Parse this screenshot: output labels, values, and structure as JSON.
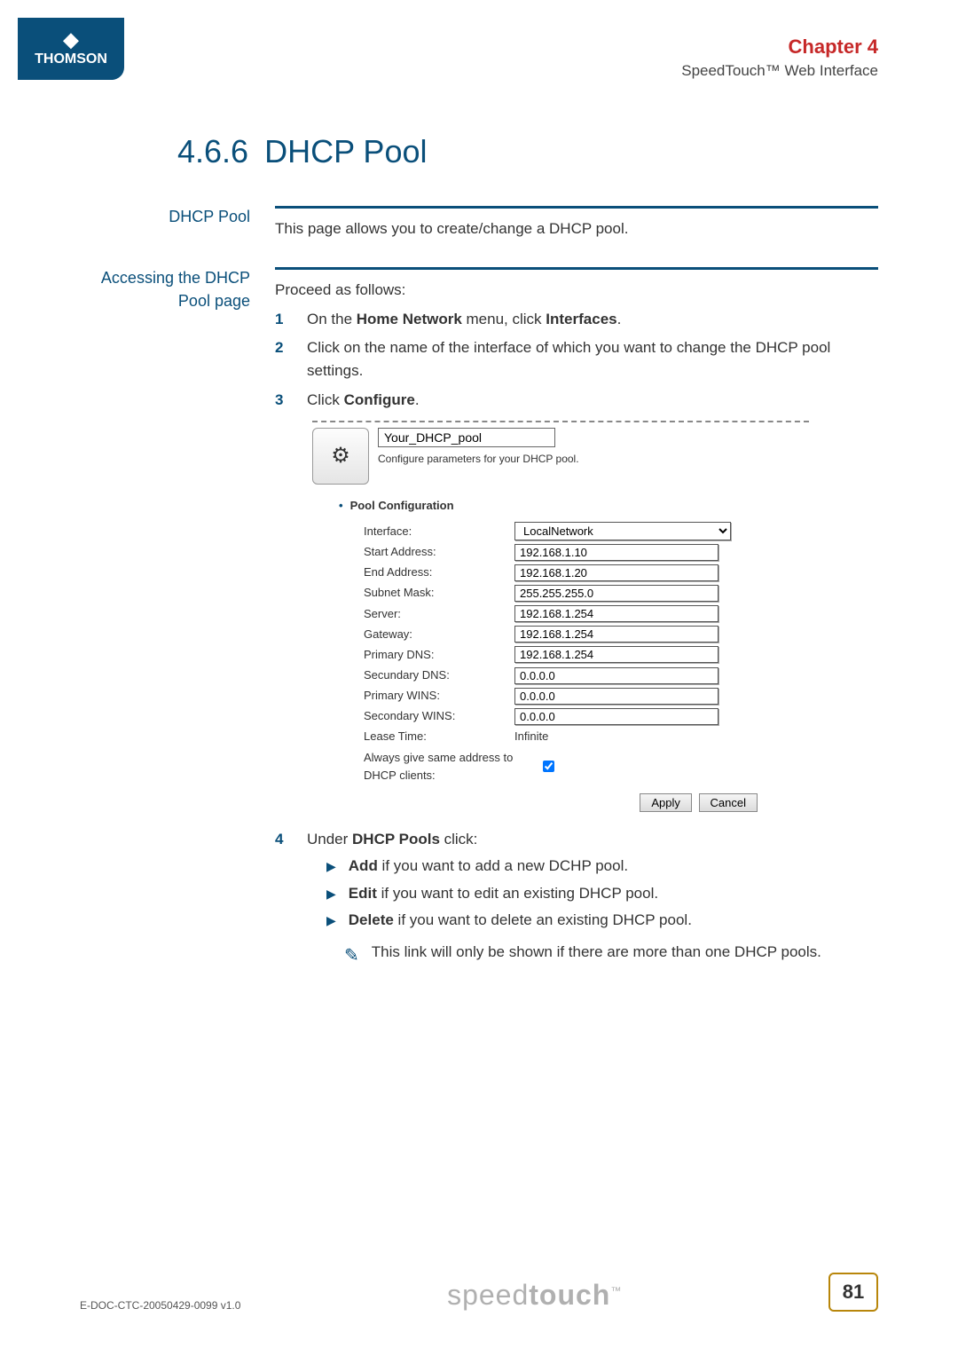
{
  "header": {
    "brand": "THOMSON",
    "chapter": "Chapter 4",
    "subtitle": "SpeedTouch™ Web Interface"
  },
  "section": {
    "num": "4.6.6",
    "title": "DHCP Pool"
  },
  "block1": {
    "margin": "DHCP Pool",
    "text": "This page allows you to create/change a DHCP pool."
  },
  "block2": {
    "margin_l1": "Accessing the DHCP",
    "margin_l2": "Pool page",
    "intro": "Proceed as follows:",
    "steps": [
      {
        "n": "1",
        "pre": "On the ",
        "b": "Home Network",
        "mid": " menu, click ",
        "b2": "Interfaces",
        "post": "."
      },
      {
        "n": "2",
        "text": "Click on the name of the interface of which you want to change the DHCP pool settings."
      },
      {
        "n": "3",
        "pre": "Click ",
        "b": "Configure",
        "post": "."
      }
    ]
  },
  "pool": {
    "name_value": "Your_DHCP_pool",
    "desc": "Configure parameters for your DHCP pool.",
    "section_title": "Pool Configuration",
    "fields": {
      "interface_label": "Interface:",
      "interface_value": "LocalNetwork",
      "start_label": "Start Address:",
      "start_value": "192.168.1.10",
      "end_label": "End Address:",
      "end_value": "192.168.1.20",
      "mask_label": "Subnet Mask:",
      "mask_value": "255.255.255.0",
      "server_label": "Server:",
      "server_value": "192.168.1.254",
      "gateway_label": "Gateway:",
      "gateway_value": "192.168.1.254",
      "pdns_label": "Primary DNS:",
      "pdns_value": "192.168.1.254",
      "sdns_label": "Secundary DNS:",
      "sdns_value": "0.0.0.0",
      "pwins_label": "Primary WINS:",
      "pwins_value": "0.0.0.0",
      "swins_label": "Secondary WINS:",
      "swins_value": "0.0.0.0",
      "lease_label": "Lease Time:",
      "lease_value": "Infinite",
      "same_addr_label": "Always give same address to DHCP clients:"
    },
    "apply": "Apply",
    "cancel": "Cancel"
  },
  "step4": {
    "n": "4",
    "pre": "Under ",
    "b": "DHCP Pools",
    "post": " click:",
    "bullets": [
      {
        "b": "Add",
        "t": " if you want to add a new DCHP pool."
      },
      {
        "b": "Edit",
        "t": " if you want to edit an existing DHCP pool."
      },
      {
        "b": "Delete",
        "t": " if you want to delete an existing DHCP pool."
      }
    ],
    "note": "This link will only be shown if there are more than one DHCP pools."
  },
  "footer": {
    "docid": "E-DOC-CTC-20050429-0099 v1.0",
    "logo_a": "speed",
    "logo_b": "touch",
    "tm": "™",
    "page": "81"
  }
}
